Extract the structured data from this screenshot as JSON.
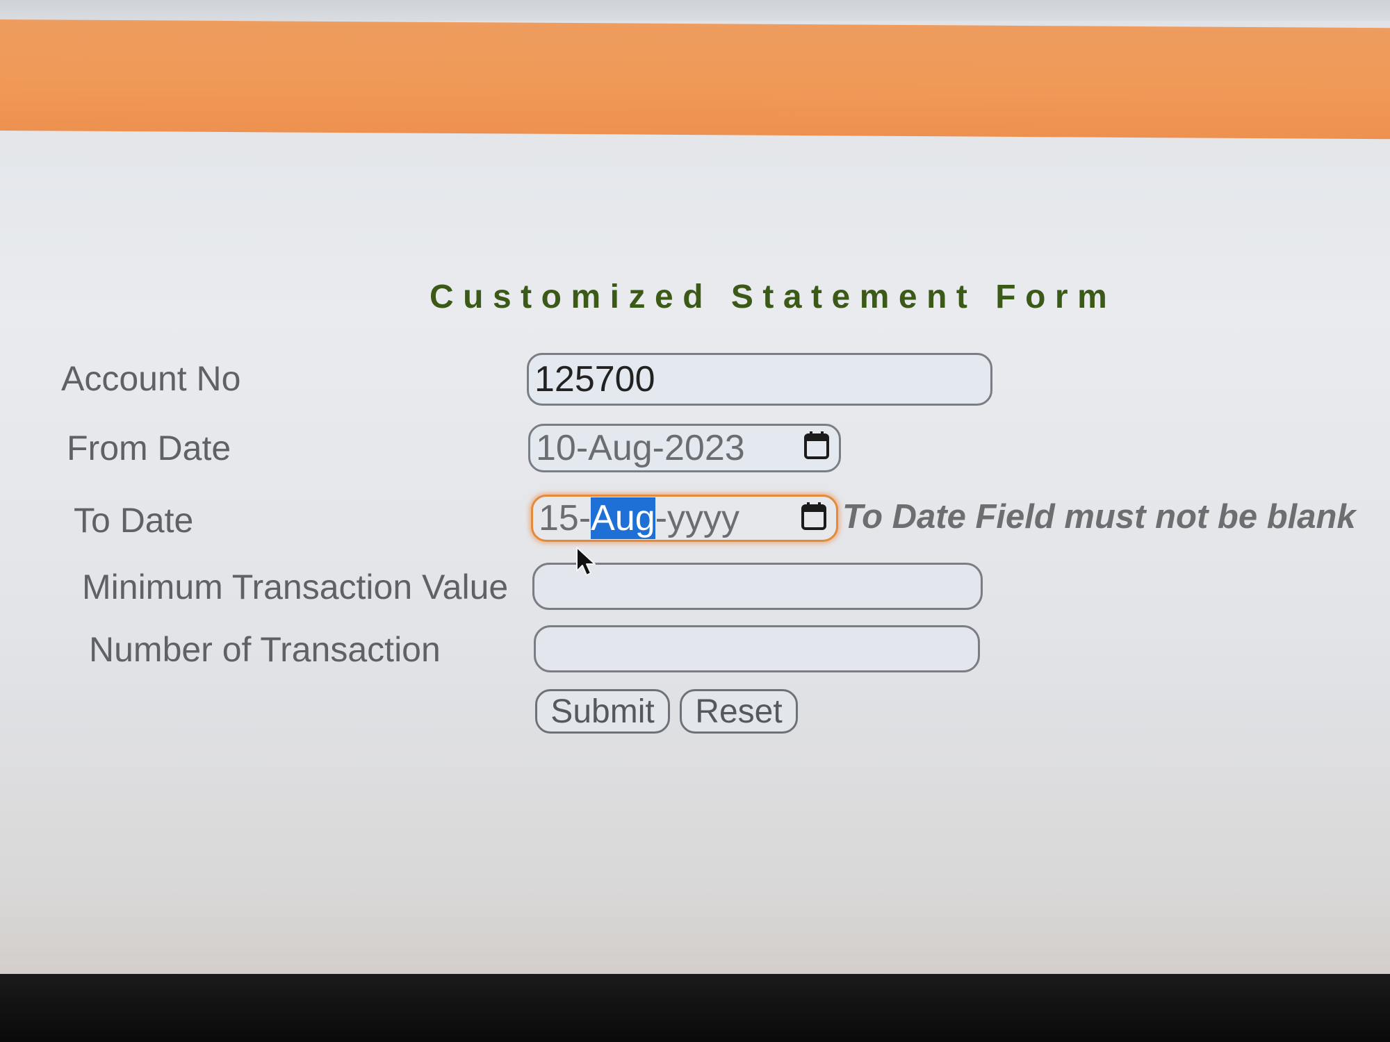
{
  "form": {
    "title": "Customized Statement Form",
    "fields": {
      "account_no": {
        "label": "Account No",
        "value": "125700"
      },
      "from_date": {
        "label": "From Date",
        "value": "10-Aug-2023"
      },
      "to_date": {
        "label": "To Date",
        "day": "15-",
        "month_selected": "Aug",
        "year_placeholder": "-yyyy"
      },
      "min_transaction_value": {
        "label": "Minimum Transaction Value",
        "value": ""
      },
      "number_of_transaction": {
        "label": "Number of Transaction",
        "value": ""
      }
    },
    "error": "To Date Field must not be blank",
    "buttons": {
      "submit": "Submit",
      "reset": "Reset"
    }
  },
  "icons": {
    "from_date_picker": "calendar-icon",
    "to_date_picker": "calendar-icon",
    "pointer": "mouse-cursor-icon"
  },
  "colors": {
    "header_band": "#f09a58",
    "title": "#3c5a17",
    "focus_ring": "#e48a3a",
    "selection": "#1e6fd6",
    "label": "#5e6266",
    "error": "#6c6e70"
  }
}
